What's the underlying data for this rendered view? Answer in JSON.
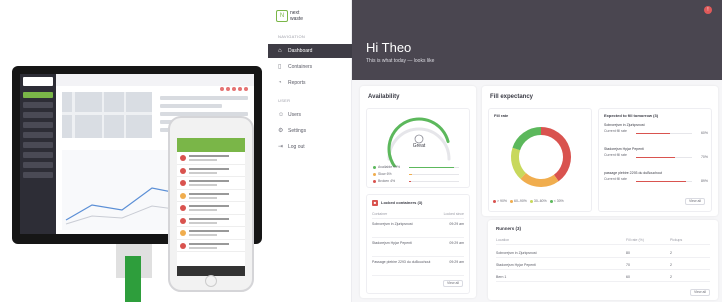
{
  "app": {
    "sidebar": {
      "logo_top": "next",
      "logo_bottom": "waste",
      "section_main": "NAVIGATION",
      "section_user": "USER",
      "items": [
        {
          "label": "Dashboard",
          "active": true
        },
        {
          "label": "Containers",
          "active": false
        },
        {
          "label": "Reports",
          "active": false
        }
      ],
      "user_items": [
        {
          "label": "Users"
        },
        {
          "label": "Settings"
        },
        {
          "label": "Log out"
        }
      ]
    },
    "header": {
      "greeting": "Hi Theo",
      "subtitle": "This is what today — looks like"
    },
    "availability": {
      "title": "Availability",
      "gauge_label": "Great",
      "gauge_level": 0.78,
      "legend": [
        {
          "label": "Available",
          "value": "90%",
          "color": "#5cb85c"
        },
        {
          "label": "Slow",
          "value": "6%",
          "color": "#f0ad4e"
        },
        {
          "label": "Broken",
          "value": "4%",
          "color": "#d9534f"
        }
      ]
    },
    "locked": {
      "title": "Locked containers",
      "count": "(3)",
      "col_container": "Container",
      "col_distance": "Locked since",
      "rows": [
        {
          "name": "Sobrorejsm in Zjurkpsnost",
          "value": "09:29 am"
        },
        {
          "name": "Stadorejsm Hpjar Pepenti",
          "value": "09:29 am"
        },
        {
          "name": "Passage plebire 2293 du duBouchout",
          "value": "09:29 am"
        }
      ],
      "view_all": "View all"
    },
    "fill": {
      "title": "Fill expectancy",
      "rate_title": "Fill rate",
      "donut": [
        {
          "label": "> 90%",
          "value": 40,
          "color": "#d9534f"
        },
        {
          "label": "60–90%",
          "value": 22,
          "color": "#f0ad4e"
        },
        {
          "label": "30–60%",
          "value": 18,
          "color": "#c8d85c"
        },
        {
          "label": "< 30%",
          "value": 20,
          "color": "#5cb85c"
        }
      ],
      "expected_title": "Expected to fill tomorrow",
      "expected_count": "(3)",
      "expected": [
        {
          "name": "Sobrorejsm in Zjurkpsnost",
          "sub": "Current fill rate",
          "pct": "60%",
          "level": 0.6
        },
        {
          "name": "Stadorejsm Hpjar Pepenti",
          "sub": "Current fill rate",
          "pct": "70%",
          "level": 0.7
        },
        {
          "name": "passage plebire 2293 du duBouchout",
          "sub": "Current fill rate",
          "pct": "89%",
          "level": 0.89
        }
      ],
      "expected_view_all": "View all"
    },
    "runners": {
      "title": "Runners",
      "count": "(3)",
      "col_location": "Location",
      "col_fill": "Fill rate (%)",
      "col_pickups": "Pickups",
      "rows": [
        {
          "name": "Sobrorejsm in Zjurkpsnost",
          "fill": "80",
          "pickups": "2"
        },
        {
          "name": "Stadorejsm Hpjar Pepenti",
          "fill": "70",
          "pickups": "2"
        },
        {
          "name": "Bern 1",
          "fill": "60",
          "pickups": "2"
        }
      ],
      "view_all": "View all"
    }
  }
}
